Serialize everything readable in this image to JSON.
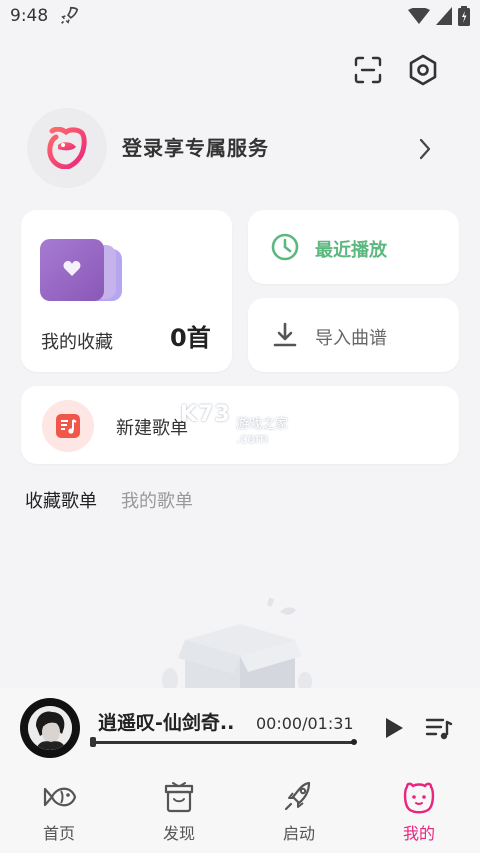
{
  "status_bar": {
    "time": "9:48"
  },
  "header": {
    "login_text": "登录享专属服务"
  },
  "favorites": {
    "label": "我的收藏",
    "count": "0首"
  },
  "recent": {
    "label": "最近播放"
  },
  "import": {
    "label": "导入曲谱"
  },
  "new_playlist": {
    "label": "新建歌单"
  },
  "watermark": {
    "logo_text": "K73",
    "sub_text": "游戏之家",
    "domain": ".com"
  },
  "tabs": [
    {
      "label": "收藏歌单",
      "active": true
    },
    {
      "label": "我的歌单",
      "active": false
    }
  ],
  "player": {
    "title": "逍遥叹-仙剑奇..",
    "time": "00:00/01:31",
    "progress": 0
  },
  "nav": [
    {
      "label": "首页",
      "icon": "fish-icon"
    },
    {
      "label": "发现",
      "icon": "box-icon"
    },
    {
      "label": "启动",
      "icon": "rocket-icon"
    },
    {
      "label": "我的",
      "icon": "face-icon",
      "active": true
    }
  ],
  "colors": {
    "accent": "#e8267d",
    "recent_green": "#5bb97f",
    "cover_purple": "#9b6cc7",
    "background": "#f4f4f6"
  }
}
